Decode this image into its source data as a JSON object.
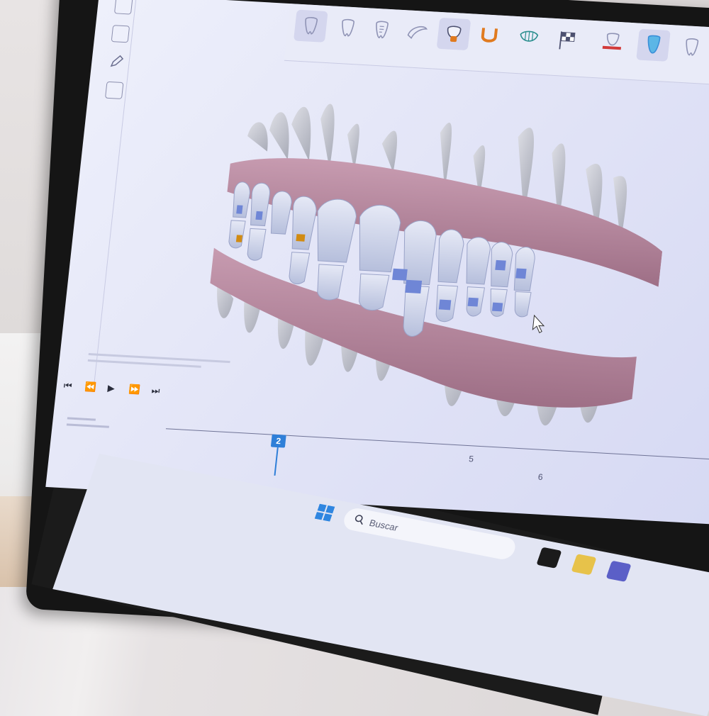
{
  "scene": {
    "description_hidden": false
  },
  "toolbar": {
    "tools": [
      {
        "icon": "tooth-view-icon"
      },
      {
        "icon": "tooth-outline-icon"
      },
      {
        "icon": "tooth-text-icon"
      },
      {
        "icon": "jaw-icon"
      },
      {
        "icon": "tooth-crown-icon",
        "active": true
      },
      {
        "icon": "arch-u-icon"
      },
      {
        "icon": "tooth-segment-icon"
      },
      {
        "icon": "finish-flag-icon"
      },
      {
        "icon": "gum-tooth-red-icon"
      },
      {
        "icon": "tooth-blue-icon"
      },
      {
        "icon": "tooth-single-icon"
      }
    ],
    "accent_orange": "#e07a1f",
    "accent_blue": "#3a8fd8"
  },
  "timeline": {
    "current_stage": "2",
    "stages_visible": [
      "5",
      "6"
    ]
  },
  "taskbar": {
    "search_placeholder": "Buscar"
  },
  "colors": {
    "gum": "#b5879c",
    "tooth": "#c9cad0",
    "bracket_blue": "#6f86d6",
    "bracket_gold": "#d18b12"
  }
}
